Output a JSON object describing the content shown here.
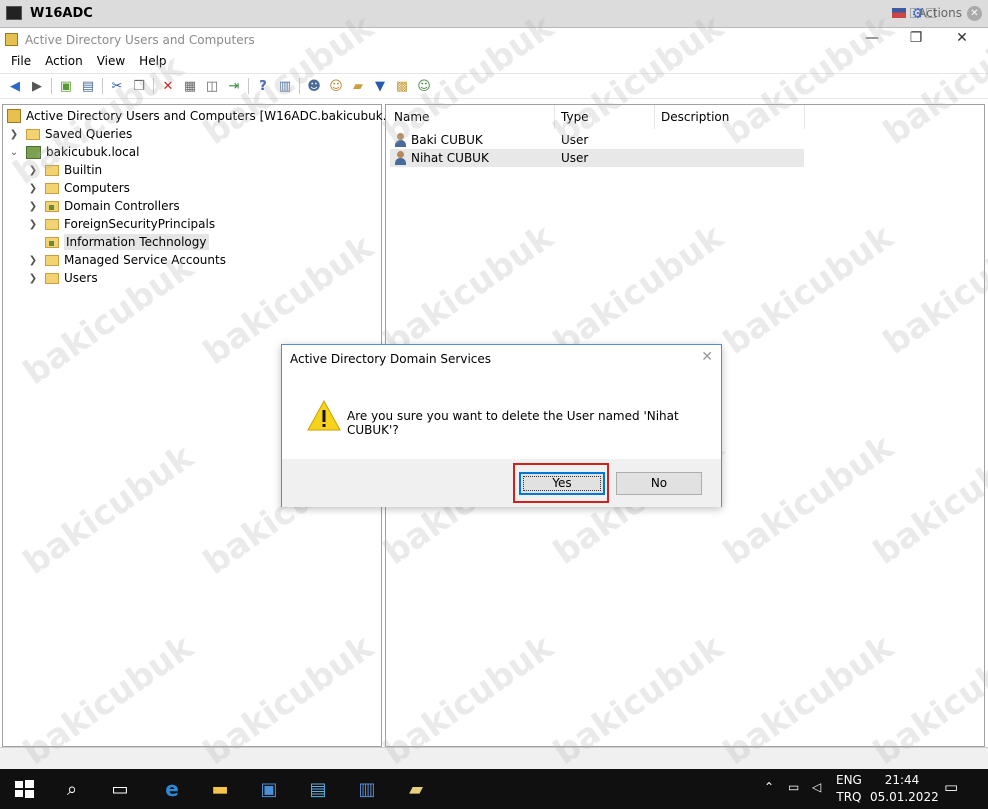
{
  "vm": {
    "title": "W16ADC",
    "actions_label": "Actions"
  },
  "window": {
    "title": "Active Directory Users and Computers",
    "minimize": "—",
    "restore": "❐",
    "close": "✕"
  },
  "menu": [
    "File",
    "Action",
    "View",
    "Help"
  ],
  "toolbar_icons": [
    "back-arrow-icon",
    "forward-arrow-icon",
    "up-folder-icon",
    "console-tree-icon",
    "cut-icon",
    "copy-icon",
    "delete-icon",
    "properties-icon",
    "refresh-icon",
    "export-icon",
    "help-icon",
    "mmc-icon",
    "create-user-icon",
    "create-group-icon",
    "create-ou-icon",
    "filter-icon",
    "find-icon",
    "add-to-group-icon"
  ],
  "tree": {
    "root": "Active Directory Users and Computers [W16ADC.bakicubuk.local]",
    "saved_queries": "Saved Queries",
    "domain": "bakicubuk.local",
    "children": [
      {
        "label": "Builtin"
      },
      {
        "label": "Computers"
      },
      {
        "label": "Domain Controllers"
      },
      {
        "label": "ForeignSecurityPrincipals"
      },
      {
        "label": "Information Technology"
      },
      {
        "label": "Managed Service Accounts"
      },
      {
        "label": "Users"
      }
    ]
  },
  "list": {
    "columns": [
      "Name",
      "Type",
      "Description"
    ],
    "rows": [
      {
        "name": "Baki CUBUK",
        "type": "User"
      },
      {
        "name": "Nihat CUBUK",
        "type": "User"
      }
    ]
  },
  "dialog": {
    "title": "Active Directory Domain Services",
    "close": "✕",
    "message": "Are you sure you want to delete the User named 'Nihat CUBUK'?",
    "yes_label": "Yes",
    "no_label": "No"
  },
  "watermark": "bakicubuk",
  "taskbar": {
    "language_top": "ENG",
    "language_bottom": "TRQ",
    "time": "21:44",
    "date": "05.01.2022"
  },
  "colors": {
    "accent": "#0078d7",
    "highlight_box": "#d02020",
    "taskbar": "#101010"
  }
}
